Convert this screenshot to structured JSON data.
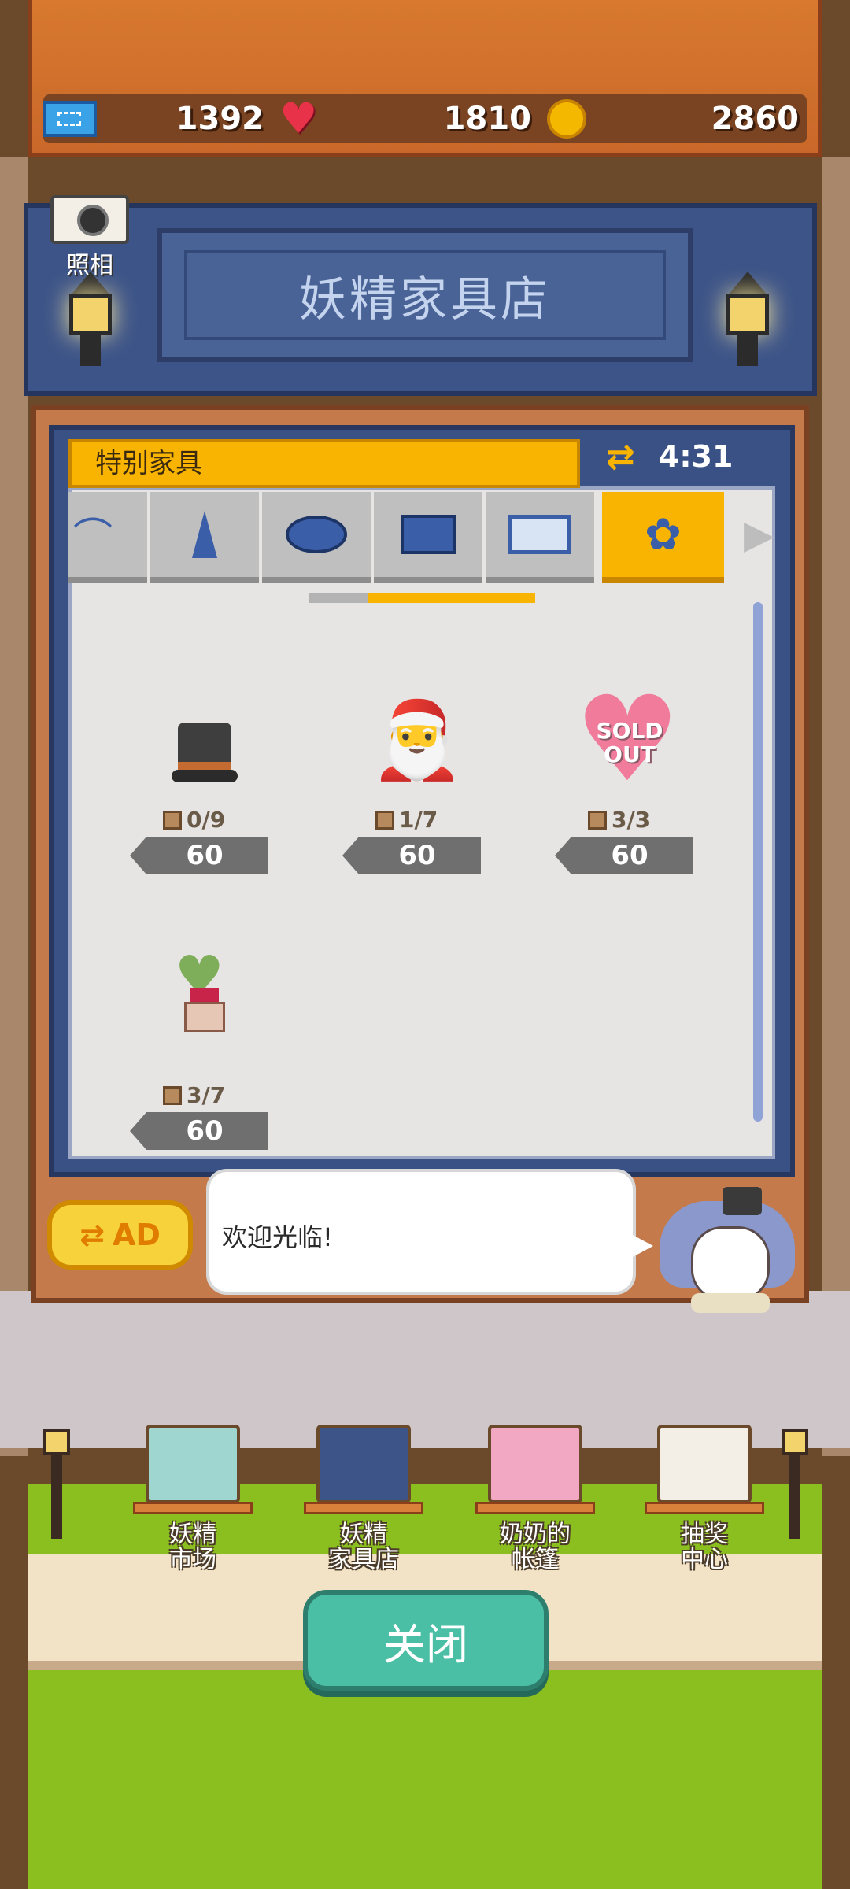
{
  "currencies": {
    "tickets": "1392",
    "hearts": "1810",
    "coins": "2860"
  },
  "camera": {
    "label": "照相"
  },
  "shop": {
    "title": "妖精家具店",
    "section_label": "特别家具",
    "timer": "4:31",
    "categories": [
      {
        "icon": "lamp-icon"
      },
      {
        "icon": "cone-icon"
      },
      {
        "icon": "rug-icon"
      },
      {
        "icon": "cabinet-icon"
      },
      {
        "icon": "laptop-icon"
      },
      {
        "icon": "flower-icon",
        "active": true
      }
    ],
    "items": [
      {
        "name_icon": "top-hat",
        "stock": "0/9",
        "price": "60"
      },
      {
        "name_icon": "santa",
        "stock": "1/7",
        "price": "60"
      },
      {
        "name_icon": "heart-sofa",
        "stock": "3/3",
        "price": "60",
        "sold_out_text": "SOLD OUT"
      },
      {
        "name_icon": "heart-plant",
        "stock": "3/7",
        "price": "60"
      }
    ],
    "ad_label": "AD",
    "greeting": "欢迎光临!"
  },
  "bottom_nav": {
    "items": [
      {
        "label1": "妖精",
        "label2": "市场"
      },
      {
        "label1": "妖精",
        "label2": "家具店"
      },
      {
        "label1": "奶奶的",
        "label2": "帐篷"
      },
      {
        "label1": "抽奖",
        "label2": "中心"
      }
    ],
    "close_label": "关闭"
  },
  "colors": {
    "accent": "#f8b400",
    "panel_blue": "#3d5488",
    "close_button": "#4abfa5"
  }
}
